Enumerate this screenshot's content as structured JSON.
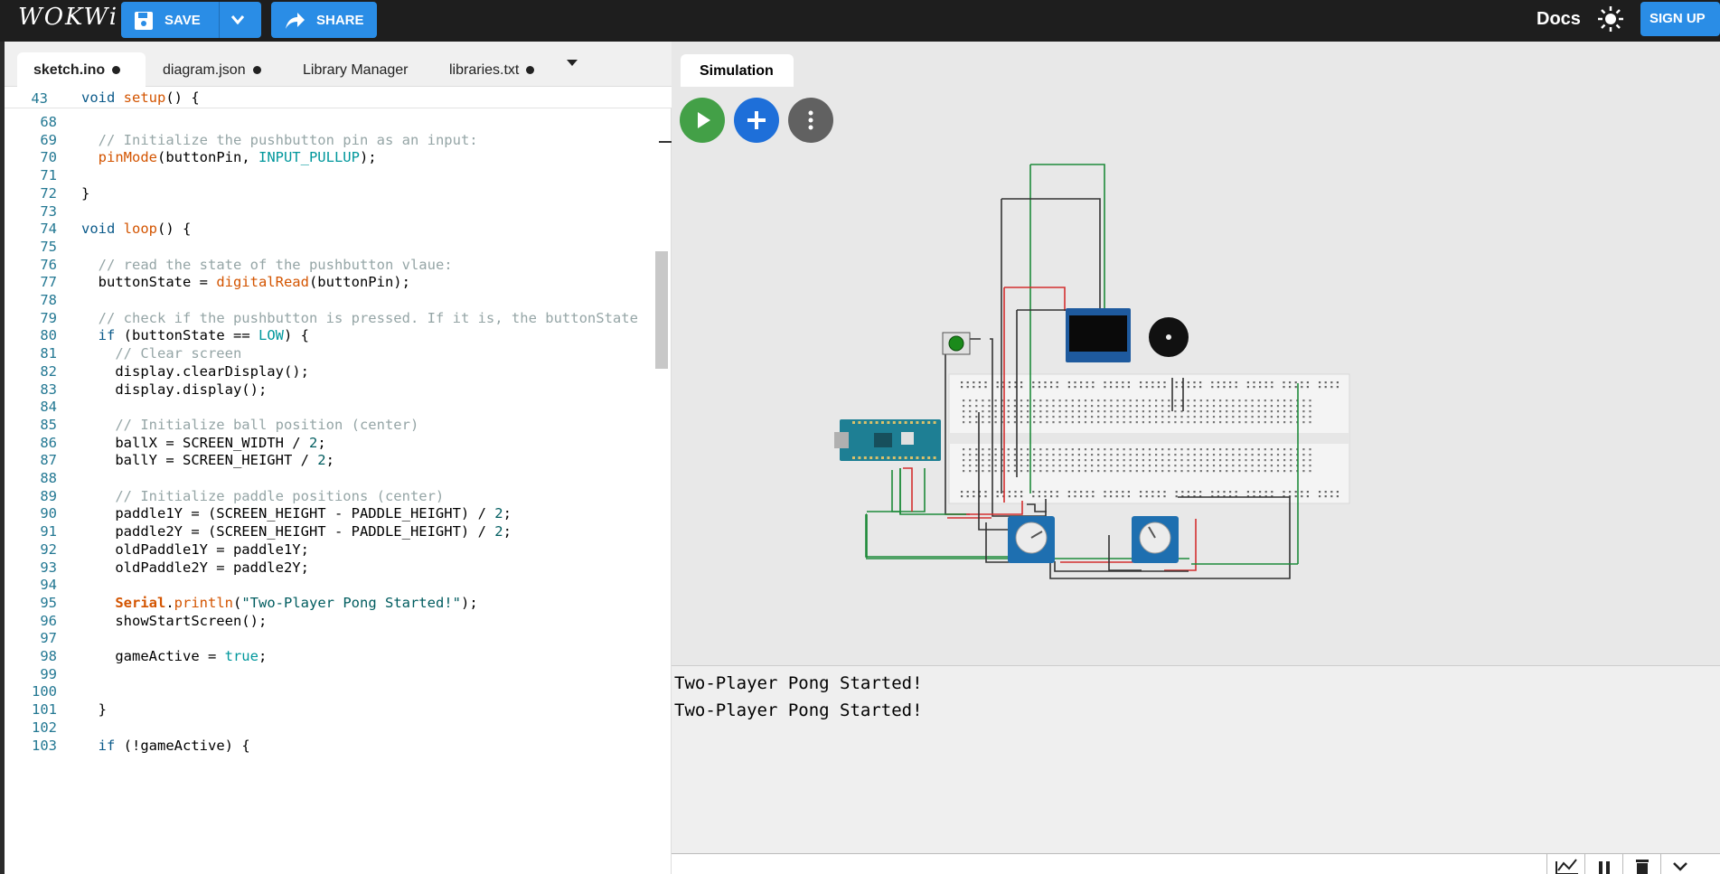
{
  "header": {
    "logo": "WOKWi",
    "save_label": "SAVE",
    "share_label": "SHARE",
    "docs_label": "Docs",
    "signup_label": "SIGN UP"
  },
  "tabs": [
    {
      "label": "sketch.ino",
      "modified": true,
      "active": true
    },
    {
      "label": "diagram.json",
      "modified": true,
      "active": false
    },
    {
      "label": "Library Manager",
      "modified": false,
      "active": false
    },
    {
      "label": "libraries.txt",
      "modified": true,
      "active": false
    }
  ],
  "sticky_line": {
    "num": "43",
    "text": "void setup() {"
  },
  "code_lines": [
    {
      "num": "68",
      "text": ""
    },
    {
      "num": "69",
      "text": "  // Initialize the pushbutton pin as an input:"
    },
    {
      "num": "70",
      "text": "  pinMode(buttonPin, INPUT_PULLUP);"
    },
    {
      "num": "71",
      "text": ""
    },
    {
      "num": "72",
      "text": "}"
    },
    {
      "num": "73",
      "text": ""
    },
    {
      "num": "74",
      "text": "void loop() {"
    },
    {
      "num": "75",
      "text": ""
    },
    {
      "num": "76",
      "text": "  // read the state of the pushbutton vlaue:"
    },
    {
      "num": "77",
      "text": "  buttonState = digitalRead(buttonPin);"
    },
    {
      "num": "78",
      "text": ""
    },
    {
      "num": "79",
      "text": "  // check if the pushbutton is pressed. If it is, the buttonState"
    },
    {
      "num": "80",
      "text": "  if (buttonState == LOW) {"
    },
    {
      "num": "81",
      "text": "    // Clear screen"
    },
    {
      "num": "82",
      "text": "    display.clearDisplay();"
    },
    {
      "num": "83",
      "text": "    display.display();"
    },
    {
      "num": "84",
      "text": ""
    },
    {
      "num": "85",
      "text": "    // Initialize ball position (center)"
    },
    {
      "num": "86",
      "text": "    ballX = SCREEN_WIDTH / 2;"
    },
    {
      "num": "87",
      "text": "    ballY = SCREEN_HEIGHT / 2;"
    },
    {
      "num": "88",
      "text": ""
    },
    {
      "num": "89",
      "text": "    // Initialize paddle positions (center)"
    },
    {
      "num": "90",
      "text": "    paddle1Y = (SCREEN_HEIGHT - PADDLE_HEIGHT) / 2;"
    },
    {
      "num": "91",
      "text": "    paddle2Y = (SCREEN_HEIGHT - PADDLE_HEIGHT) / 2;"
    },
    {
      "num": "92",
      "text": "    oldPaddle1Y = paddle1Y;"
    },
    {
      "num": "93",
      "text": "    oldPaddle2Y = paddle2Y;"
    },
    {
      "num": "94",
      "text": ""
    },
    {
      "num": "95",
      "text": "    Serial.println(\"Two-Player Pong Started!\");"
    },
    {
      "num": "96",
      "text": "    showStartScreen();"
    },
    {
      "num": "97",
      "text": ""
    },
    {
      "num": "98",
      "text": "    gameActive = true;"
    },
    {
      "num": "99",
      "text": ""
    },
    {
      "num": "100",
      "text": ""
    },
    {
      "num": "101",
      "text": "  }"
    },
    {
      "num": "102",
      "text": ""
    },
    {
      "num": "103",
      "text": "  if (!gameActive) {"
    }
  ],
  "simulation": {
    "tab_label": "Simulation"
  },
  "serial_output": [
    "Two-Player Pong Started!",
    "Two-Player Pong Started!"
  ],
  "colors": {
    "accent": "#2a8de6",
    "play": "#43a047",
    "add": "#1e6fd9"
  }
}
